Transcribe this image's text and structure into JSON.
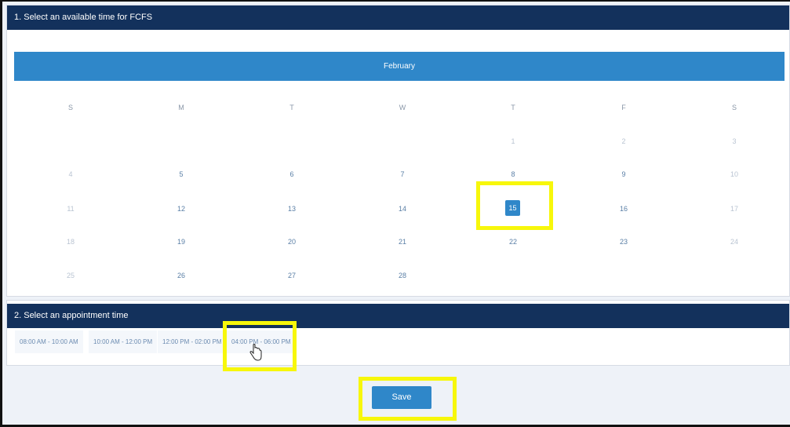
{
  "section1": {
    "title": "1. Select an available time for FCFS"
  },
  "calendar": {
    "month": "February",
    "weekdays": [
      "S",
      "M",
      "T",
      "W",
      "T",
      "F",
      "S"
    ],
    "weeks": [
      [
        "",
        "",
        "",
        "",
        "1",
        "2",
        "3"
      ],
      [
        "4",
        "5",
        "6",
        "7",
        "8",
        "9",
        "10"
      ],
      [
        "11",
        "12",
        "13",
        "14",
        "15",
        "16",
        "17"
      ],
      [
        "18",
        "19",
        "20",
        "21",
        "22",
        "23",
        "24"
      ],
      [
        "25",
        "26",
        "27",
        "28",
        "",
        "",
        ""
      ]
    ],
    "selected_day": "15"
  },
  "section2": {
    "title": "2. Select an appointment time",
    "time_slots": [
      "08:00 AM - 10:00 AM",
      "10:00 AM - 12:00 PM",
      "12:00 PM - 02:00 PM",
      "04:00 PM - 06:00 PM"
    ]
  },
  "save_label": "Save",
  "colors": {
    "header_bg": "#13315c",
    "accent": "#2f87c9",
    "highlight": "#f7f70b"
  },
  "icons": {
    "cursor": "hand-pointer-icon"
  }
}
